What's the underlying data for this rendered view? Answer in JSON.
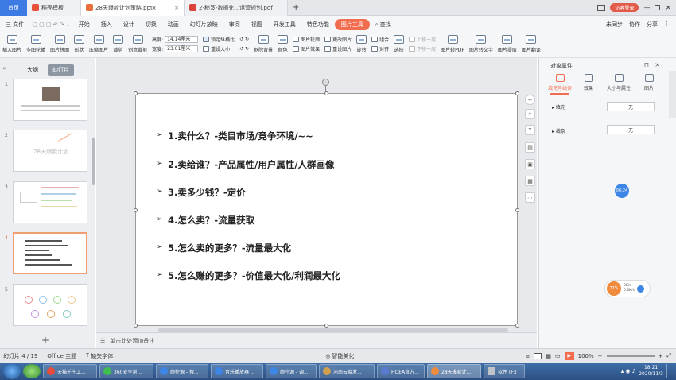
{
  "tabs": {
    "home": "首页",
    "tab1": "稻壳模板",
    "tab2": "28天爆款计划策略.pptx",
    "tab3": "2-秘笈-数据化...运营规划.pdf",
    "new_tab": "+",
    "visitor": "访客登录"
  },
  "menu": {
    "file": "三 文件",
    "items": [
      "开始",
      "插入",
      "设计",
      "切换",
      "动画",
      "幻灯片放映",
      "审阅",
      "视图",
      "开发工具",
      "特色功能"
    ],
    "picture_tools": "图片工具",
    "search": "查找",
    "sync": "未同步",
    "collab": "协作",
    "share": "分享"
  },
  "ribbon": {
    "insert_picture": "插入图片",
    "multi_pic": "多图轮播",
    "pic_group": "图片拼图",
    "shape": "形状",
    "compress": "压缩图片",
    "crop": "裁剪",
    "create_crop": "创意裁剪",
    "height_label": "高度:",
    "height_value": "14.14厘米",
    "width_label": "宽度:",
    "width_value": "23.01厘米",
    "lock_ratio": "锁定纵横比",
    "reset_size": "重设大小",
    "remove_bg": "抠除背景",
    "color": "颜色",
    "pic_outline": "图片轮廓",
    "pic_effect": "图片效果",
    "change_pic": "更改图片",
    "reset_pic": "重设图片",
    "rotate": "旋转",
    "group": "组合",
    "align": "对齐",
    "select": "选择",
    "up_layer": "上移一层",
    "down_layer": "下移一层",
    "to_pdf": "图片转PDF",
    "to_text": "图片转文字",
    "extract": "图片提取",
    "translate": "图片翻译"
  },
  "leftpanel": {
    "outline_tab": "大纲",
    "slides_tab": "幻灯片",
    "slide_numbers": [
      "1",
      "2",
      "3",
      "4",
      "5"
    ],
    "slide2_title": "28天爆款计划",
    "add": "+"
  },
  "slide": {
    "bullet_mark": "➢",
    "items": [
      "1.卖什么？-类目市场/竞争环境/~~",
      "2.卖给谁？-产品属性/用户属性/人群画像",
      "3.卖多少钱？-定价",
      "4.怎么卖？-流量获取",
      "5.怎么卖的更多？-流量最大化",
      "5.怎么赚的更多？-价值最大化/利润最大化"
    ]
  },
  "rightpanel": {
    "title": "对象属性",
    "tabs": [
      "填充与线条",
      "效果",
      "大小与属性",
      "图片"
    ],
    "fill_label": "填充",
    "fill_value": "无",
    "line_label": "线条",
    "line_value": "无"
  },
  "float": {
    "time_badge": "06:24",
    "progress": "77%",
    "stat1": "0K/s",
    "stat2": "0.3K/s"
  },
  "notes": {
    "placeholder": "单击此处添加备注"
  },
  "status": {
    "slide_counter": "幻灯片 4 / 19",
    "theme": "Office 主题",
    "missing_font": "缺失字体",
    "smart_beautify": "智能美化",
    "zoom": "100%"
  },
  "taskbar": {
    "items": [
      "天猫千牛工...",
      "360安全浏...",
      "颜控源 - 搜...",
      "音乐播放器 ...",
      "颜控源 - 调...",
      "河南云俊发...",
      "HOEA官方...",
      "28天爆款计...",
      "软件 (F:)"
    ],
    "time": "18:21",
    "date": "2020/11/3"
  },
  "colors": {
    "accent": "#f26c4f",
    "home_tab": "#3d7be4",
    "selected_slide_border": "#f0a070",
    "badge_blue": "#3d86e6",
    "taskbar": "#2b5083"
  }
}
